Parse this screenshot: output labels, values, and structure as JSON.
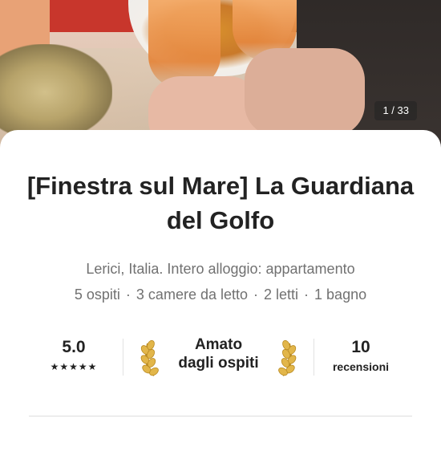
{
  "gallery": {
    "counter": "1 / 33"
  },
  "listing": {
    "title": "[Finestra sul Mare] La Guardiana del Golfo",
    "subtitle": "Lerici, Italia. Intero alloggio: appartamento",
    "facts": [
      "5 ospiti",
      "3 camere da letto",
      "2 letti",
      "1 bagno"
    ],
    "fact_separator": "·"
  },
  "stats": {
    "rating": "5.0",
    "stars": "★★★★★",
    "badge_line1": "Amato",
    "badge_line2": "dagli ospiti",
    "reviews_count": "10",
    "reviews_label": "recensioni",
    "laurel_icon": "laurel-icon",
    "laurel_color": "#e2b64a"
  }
}
